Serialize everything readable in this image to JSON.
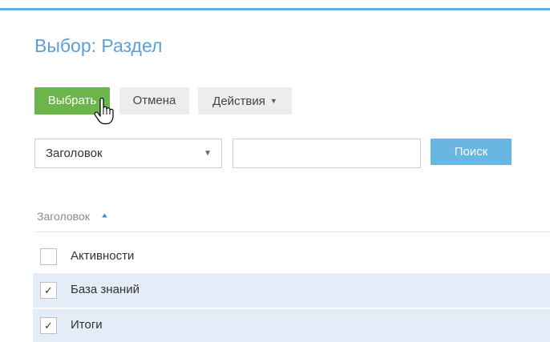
{
  "page": {
    "title": "Выбор: Раздел"
  },
  "toolbar": {
    "select_label": "Выбрать",
    "cancel_label": "Отмена",
    "actions_label": "Действия"
  },
  "filter": {
    "column_value": "Заголовок",
    "search_value": "",
    "search_label": "Поиск"
  },
  "grid": {
    "column_header": "Заголовок",
    "sort": "ascending",
    "rows": [
      {
        "label": "Активности",
        "checked": false
      },
      {
        "label": "База знаний",
        "checked": true
      },
      {
        "label": "Итоги",
        "checked": true
      }
    ]
  },
  "colors": {
    "accent_blue": "#5b9fd8",
    "select_green": "#6bb54a",
    "search_blue": "#68b7e3",
    "selected_row": "#e4ecf8"
  },
  "icons": {
    "cursor": "hand-pointer-icon",
    "sort": "sort-ascending-icon",
    "dropdown": "caret-down-icon",
    "check": "checkmark-icon"
  }
}
